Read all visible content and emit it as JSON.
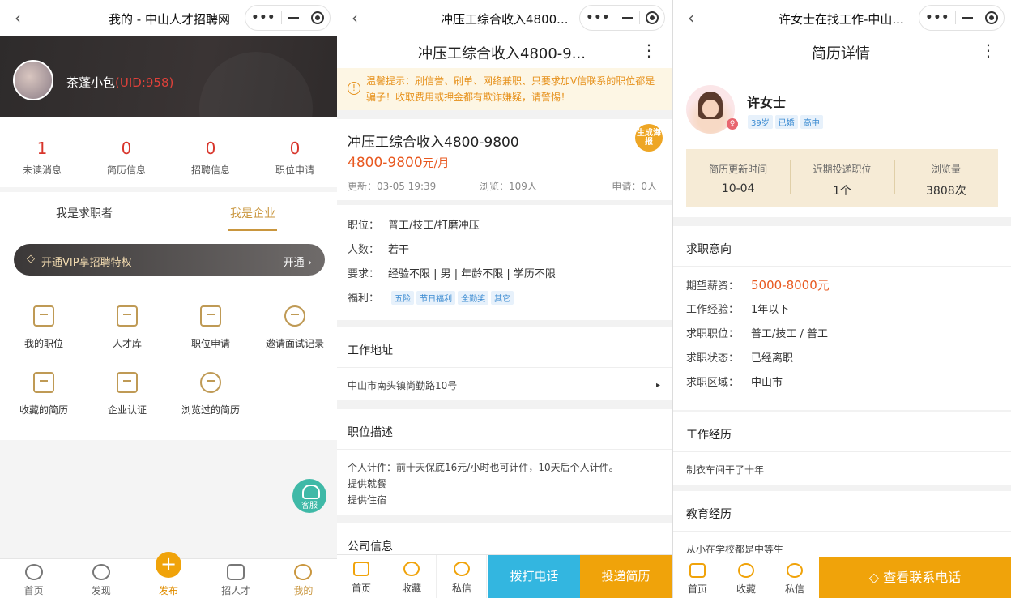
{
  "panel1": {
    "title": "我的 - 中山人才招聘网",
    "user_name": "茶蓬小包",
    "uid": "(UID:958)",
    "stats": [
      {
        "num": "1",
        "label": "未读消息"
      },
      {
        "num": "0",
        "label": "简历信息"
      },
      {
        "num": "0",
        "label": "招聘信息"
      },
      {
        "num": "0",
        "label": "职位申请"
      }
    ],
    "tabs": [
      "我是求职者",
      "我是企业"
    ],
    "vip_label": "开通VIP享招聘特权",
    "vip_action": "开通 ›",
    "grid": [
      "我的职位",
      "人才库",
      "职位申请",
      "邀请面试记录",
      "收藏的简历",
      "企业认证",
      "浏览过的简历"
    ],
    "kefu": "客服",
    "bottom_nav": [
      "首页",
      "发现",
      "发布",
      "招人才",
      "我的"
    ],
    "publish_symbol": "+"
  },
  "panel2": {
    "title": "冲压工综合收入4800...",
    "header": "冲压工综合收入4800-9...",
    "notice": "温馨提示：刷信誉、刷单、网络兼职、只要求加V信联系的职位都是骗子！收取费用或押金都有欺诈嫌疑，请警惕！",
    "job_title": "冲压工综合收入4800-9800",
    "salary": "4800-9800",
    "salary_unit": "元/月",
    "updated": "更新：03-05 19:39",
    "views": "浏览：109人",
    "applies": "申请：0人",
    "poster": "生成海报",
    "details": [
      {
        "k": "职位：",
        "v": "普工/技工/打磨冲压"
      },
      {
        "k": "人数：",
        "v": "若干"
      },
      {
        "k": "要求：",
        "v": "经验不限 | 男 | 年龄不限 | 学历不限"
      }
    ],
    "welfare_label": "福利：",
    "welfare": [
      "五险",
      "节日福利",
      "全勤奖",
      "其它"
    ],
    "addr_head": "工作地址",
    "address": "中山市南头镇尚勤路10号",
    "desc_head": "职位描述",
    "desc_lines": [
      "个人计件：前十天保底16元/小时也可计件，10天后个人计件。",
      "提供就餐",
      "提供住宿"
    ],
    "company_head": "公司信息",
    "bottom": [
      "首页",
      "收藏",
      "私信"
    ],
    "call": "拨打电话",
    "deliver": "投递简历"
  },
  "panel3": {
    "title": "许女士在找工作-中山...",
    "header": "简历详情",
    "name": "许女士",
    "tags": [
      "39岁",
      "已婚",
      "高中"
    ],
    "stats": [
      {
        "a": "简历更新时间",
        "b": "10-04"
      },
      {
        "a": "近期投递职位",
        "b": "1个"
      },
      {
        "a": "浏览量",
        "b": "3808次"
      }
    ],
    "intent_head": "求职意向",
    "intent": [
      {
        "k": "期望薪资：",
        "v": "5000-8000元"
      },
      {
        "k": "工作经验：",
        "v": "1年以下"
      },
      {
        "k": "求职职位：",
        "v": "普工/技工 / 普工"
      },
      {
        "k": "求职状态：",
        "v": "已经离职"
      },
      {
        "k": "求职区域：",
        "v": "中山市"
      }
    ],
    "work_head": "工作经历",
    "work": "制衣车间干了十年",
    "edu_head": "教育经历",
    "edu": "从小在学校都是中等生",
    "bottom": [
      "首页",
      "收藏",
      "私信"
    ],
    "view_phone": "查看联系电话"
  },
  "colors": {
    "accent_gold": "#c9963e",
    "orange": "#f0a30a",
    "blue": "#33b6e0",
    "red": "#d8352b"
  }
}
